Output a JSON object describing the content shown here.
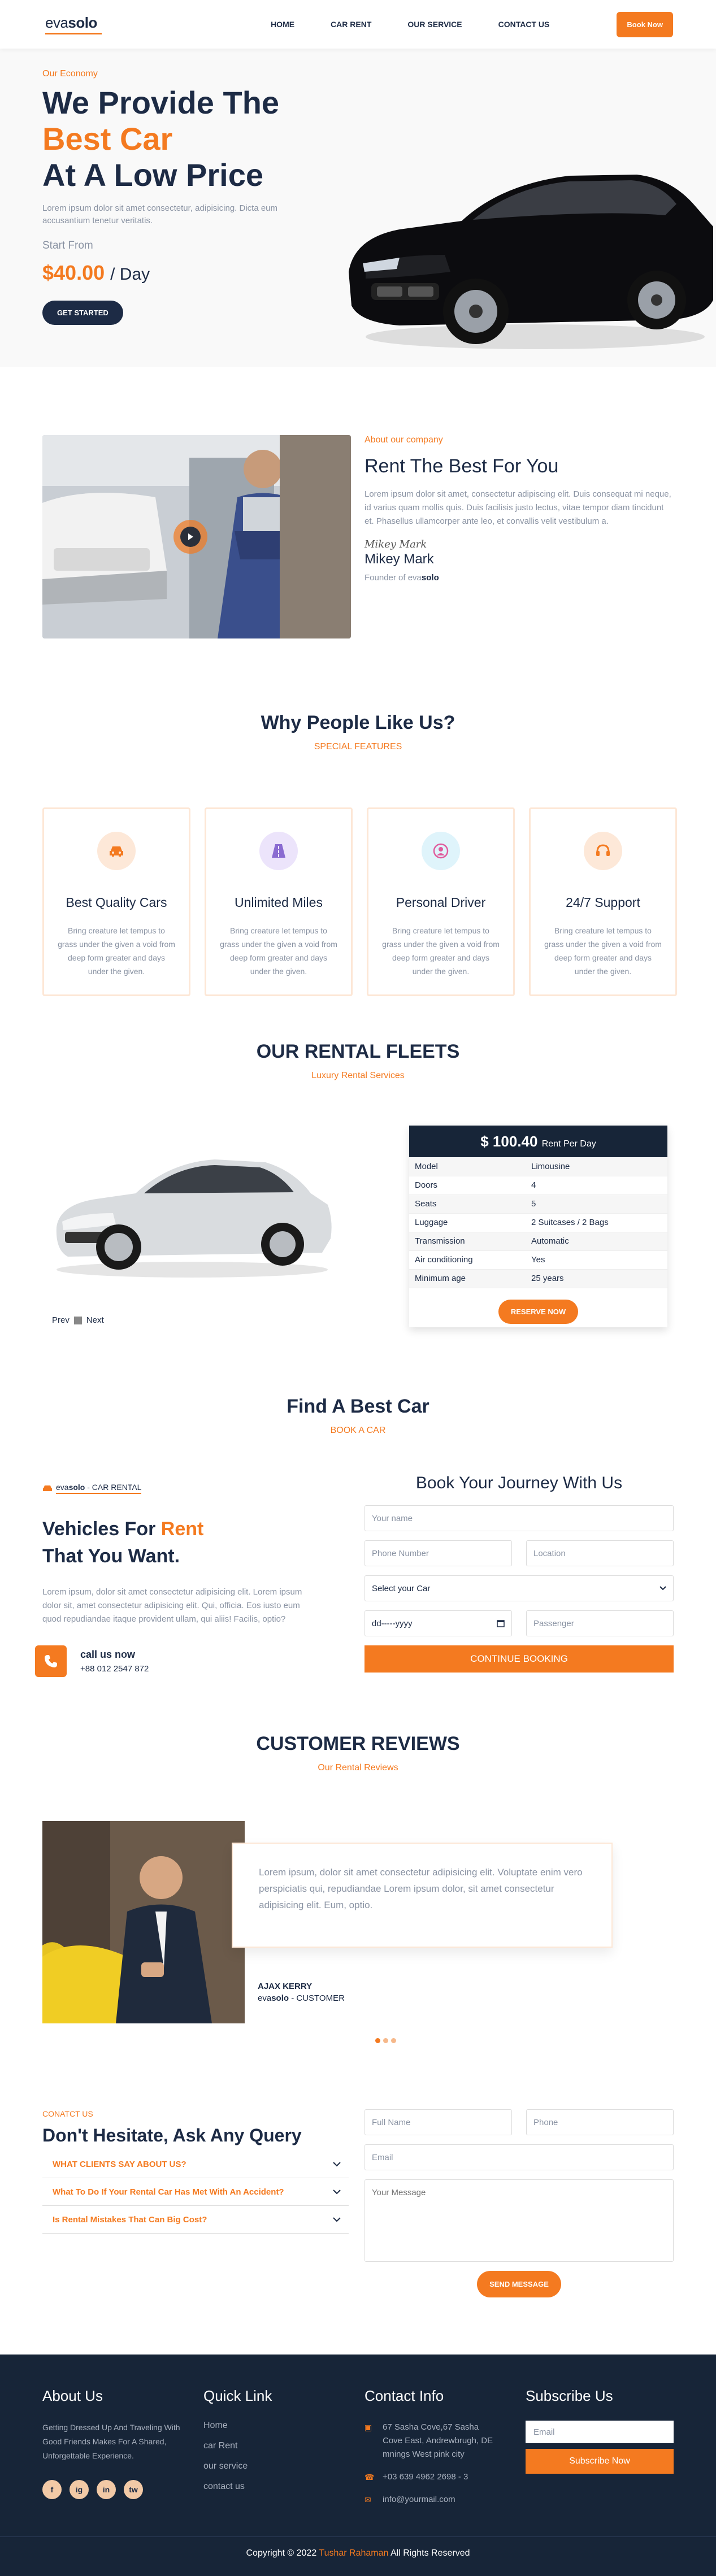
{
  "nav": {
    "logo_light": "eva",
    "logo_bold": "solo",
    "links": [
      "HOME",
      "CAR RENT",
      "OUR SERVICE",
      "CONTACT US"
    ],
    "cta": "Book Now"
  },
  "hero": {
    "eyebrow": "Our Economy",
    "line1": "We Provide The",
    "line2": "Best Car",
    "line3": "At A Low Price",
    "desc": "Lorem ipsum dolor sit amet consectetur, adipisicing. Dicta eum accusantium tenetur veritatis.",
    "start_label": "Start From",
    "price": "$40.00",
    "per": "/ Day",
    "cta": "GET STARTED"
  },
  "about": {
    "eyebrow": "About our company",
    "title": "Rent The Best For You",
    "text": "Lorem ipsum dolor sit amet, consectetur adipiscing elit. Duis consequat mi neque, id varius quam mollis quis. Duis facilisis justo lectus, vitae tempor diam tincidunt et. Phasellus ullamcorper ante leo, et convallis velit vestibulum a.",
    "signature": "Mikey Mark",
    "name": "Mikey Mark",
    "role_prefix": "Founder of eva",
    "role_bold": "solo"
  },
  "features": {
    "title": "Why People Like Us?",
    "subtitle": "SPECIAL FEATURES",
    "items": [
      {
        "title": "Best Quality Cars",
        "text": "Bring creature let tempus to grass under the given a void from deep form greater and days under the given.",
        "icon": "car-icon",
        "color": "#f47a20",
        "bg": "#fde8d8"
      },
      {
        "title": "Unlimited Miles",
        "text": "Bring creature let tempus to grass under the given a void from deep form greater and days under the given.",
        "icon": "road-icon",
        "color": "#8a6bd1",
        "bg": "#ece4fb"
      },
      {
        "title": "Personal Driver",
        "text": "Bring creature let tempus to grass under the given a void from deep form greater and days under the given.",
        "icon": "driver-icon",
        "color": "#e05a9c",
        "bg": "#dff4fb"
      },
      {
        "title": "24/7 Support",
        "text": "Bring creature let tempus to grass under the given a void from deep form greater and days under the given.",
        "icon": "headset-icon",
        "color": "#f47a20",
        "bg": "#fde8d8"
      }
    ]
  },
  "fleet": {
    "title": "OUR RENTAL FLEETS",
    "subtitle": "Luxury Rental Services",
    "price": "$ 100.40",
    "per": "Rent Per Day",
    "specs": [
      [
        "Model",
        "Limousine"
      ],
      [
        "Doors",
        "4"
      ],
      [
        "Seats",
        "5"
      ],
      [
        "Luggage",
        "2 Suitcases / 2 Bags"
      ],
      [
        "Transmission",
        "Automatic"
      ],
      [
        "Air conditioning",
        "Yes"
      ],
      [
        "Minimum age",
        "25 years"
      ]
    ],
    "cta": "RESERVE NOW",
    "prev": "Prev",
    "next": "Next"
  },
  "find": {
    "title": "Find A Best Car",
    "subtitle": "BOOK A CAR",
    "mini_light": "eva",
    "mini_bold": "solo",
    "mini_tag": " - CAR RENTAL",
    "h_a": "Vehicles For ",
    "h_b": "Rent",
    "h_c": "That You Want.",
    "text": "Lorem ipsum, dolor sit amet consectetur adipisicing elit. Lorem ipsum dolor sit, amet consectetur adipisicing elit. Qui, officia. Eos iusto eum quod repudiandae itaque provident ullam, qui aliis! Facilis, optio?",
    "call_title": "call us now",
    "call_phone": "+88 012 2547 872",
    "form_title": "Book Your Journey With Us",
    "ph_name": "Your name",
    "ph_phone": "Phone Number",
    "ph_location": "Location",
    "select": "Select your Car",
    "date": "dd-----yyyy",
    "ph_passenger": "Passenger",
    "submit": "CONTINUE BOOKING"
  },
  "reviews": {
    "title": "CUSTOMER REVIEWS",
    "subtitle": "Our Rental Reviews",
    "text": "Lorem ipsum, dolor sit amet consectetur adipisicing elit. Voluptate enim vero perspiciatis qui, repudiandae Lorem ipsum dolor, sit amet consectetur adipisicing elit. Eum, optio.",
    "name": "AJAX KERRY",
    "role_light": "eva",
    "role_bold": "solo",
    "role_tail": " - CUSTOMER"
  },
  "contact": {
    "eyebrow": "CONATCT US",
    "title": "Don't Hesitate, Ask Any Query",
    "faqs": [
      "WHAT CLIENTS SAY ABOUT US?",
      "What To Do If Your Rental Car Has Met With An Accident?",
      "Is Rental Mistakes That Can Big Cost?"
    ],
    "ph_fullname": "Full Name",
    "ph_phone": "Phone",
    "ph_email": "Email",
    "ph_message": "Your Message",
    "send": "SEND MESSAGE"
  },
  "footer": {
    "about_title": "About Us",
    "about_text": "Getting Dressed Up And Traveling With Good Friends Makes For A Shared, Unforgettable Experience.",
    "quick_title": "Quick Link",
    "links": [
      "Home",
      "car Rent",
      "our service",
      "contact us"
    ],
    "contact_title": "Contact Info",
    "address": "67 Sasha Cove,67 Sasha Cove East, Andrewbrugh, DE mnings West pink city",
    "phone": "+03 639 4962 2698 - 3",
    "email": "info@yourmail.com",
    "sub_title": "Subscribe Us",
    "sub_placeholder": "Email",
    "sub_button": "Subscribe Now",
    "copy_a": "Copyright © 2022 ",
    "copy_name": "Tushar Rahaman",
    "copy_b": " All Rights Reserved",
    "social": [
      "f",
      "ig",
      "in",
      "tw"
    ]
  }
}
